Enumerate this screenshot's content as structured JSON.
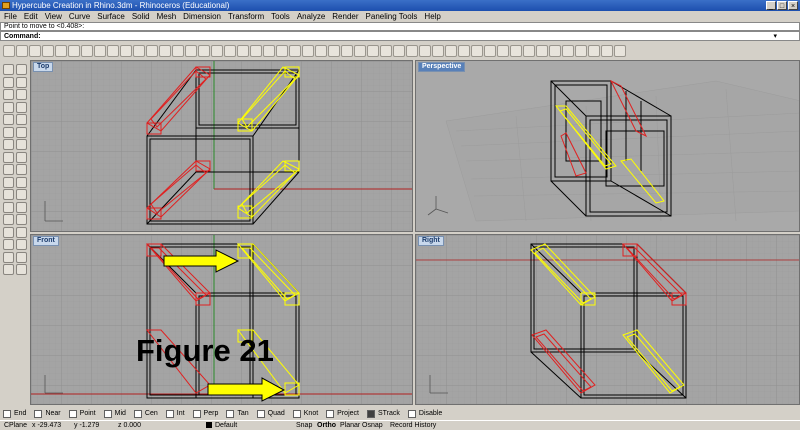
{
  "window": {
    "title": "Hypercube Creation in Rhino.3dm - Rhinoceros (Educational)"
  },
  "menu": [
    "File",
    "Edit",
    "View",
    "Curve",
    "Surface",
    "Solid",
    "Mesh",
    "Dimension",
    "Transform",
    "Tools",
    "Analyze",
    "Render",
    "Paneling Tools",
    "Help"
  ],
  "command": {
    "history": "Point to move to <0.408>:",
    "prompt": "Command:"
  },
  "viewports": {
    "top": "Top",
    "perspective": "Perspective",
    "front": "Front",
    "right": "Right"
  },
  "figure_label": "Figure 21",
  "osnaps": [
    {
      "label": "End",
      "checked": false
    },
    {
      "label": "Near",
      "checked": false
    },
    {
      "label": "Point",
      "checked": false
    },
    {
      "label": "Mid",
      "checked": false
    },
    {
      "label": "Cen",
      "checked": false
    },
    {
      "label": "Int",
      "checked": false
    },
    {
      "label": "Perp",
      "checked": false
    },
    {
      "label": "Tan",
      "checked": false
    },
    {
      "label": "Quad",
      "checked": false
    },
    {
      "label": "Knot",
      "checked": false
    },
    {
      "label": "Project",
      "checked": false
    },
    {
      "label": "STrack",
      "checked": true
    },
    {
      "label": "Disable",
      "checked": false
    }
  ],
  "status": {
    "cplane": "CPlane",
    "x": "x -29.473",
    "y": "y -1.279",
    "z": "z 0.000",
    "layer": "Default",
    "snap": "Snap",
    "ortho": "Ortho",
    "planar": "Planar",
    "osnap": "Osnap",
    "record": "Record History"
  },
  "colors": {
    "selected": "#ffff00",
    "red": "#e02020",
    "wire": "#000000",
    "arrow": "#ffff00"
  }
}
